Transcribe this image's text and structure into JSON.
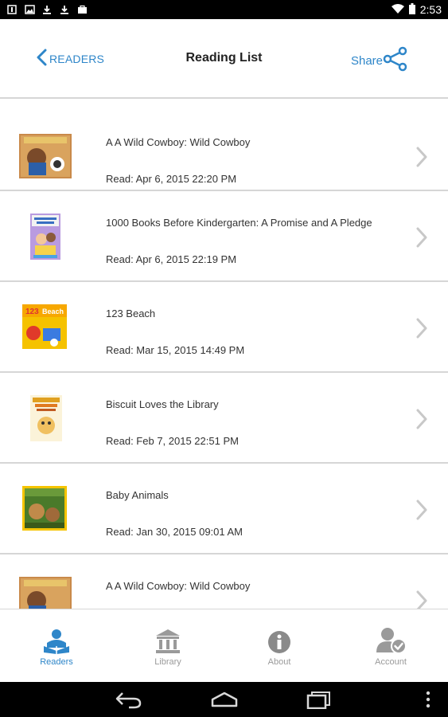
{
  "status_bar": {
    "time": "2:53",
    "left_icons": [
      "notification-icon",
      "image-icon",
      "download-icon",
      "download-icon",
      "shopping-bag-icon"
    ],
    "right_icons": [
      "wifi-icon",
      "battery-icon"
    ]
  },
  "header": {
    "back_label": "READERS",
    "title": "Reading List",
    "share_label": "Share"
  },
  "books": [
    {
      "title": "A A Wild Cowboy: Wild Cowboy",
      "read": "Read: Apr 6, 2015 22:20 PM",
      "cover": "cowboy-cover"
    },
    {
      "title": "1000 Books Before Kindergarten: A Promise and A Pledge",
      "read": "Read: Apr 6, 2015 22:19 PM",
      "cover": "kindergarten-cover"
    },
    {
      "title": "123 Beach",
      "read": "Read: Mar 15, 2015 14:49 PM",
      "cover": "beach-cover"
    },
    {
      "title": "Biscuit Loves the Library",
      "read": "Read: Feb 7, 2015 22:51 PM",
      "cover": "biscuit-cover"
    },
    {
      "title": "Baby Animals",
      "read": "Read: Jan 30, 2015 09:01 AM",
      "cover": "animals-cover"
    },
    {
      "title": "A A Wild Cowboy: Wild Cowboy",
      "read": "",
      "cover": "cowboy-cover"
    }
  ],
  "tabs": [
    {
      "label": "Readers",
      "icon": "readers-icon",
      "active": true
    },
    {
      "label": "Library",
      "icon": "library-icon",
      "active": false
    },
    {
      "label": "About",
      "icon": "info-icon",
      "active": false
    },
    {
      "label": "Account",
      "icon": "account-icon",
      "active": false
    }
  ],
  "colors": {
    "accent": "#2e86c9",
    "divider": "#d6d6d6",
    "text": "#333333",
    "tab_inactive": "#9a9a9a"
  }
}
